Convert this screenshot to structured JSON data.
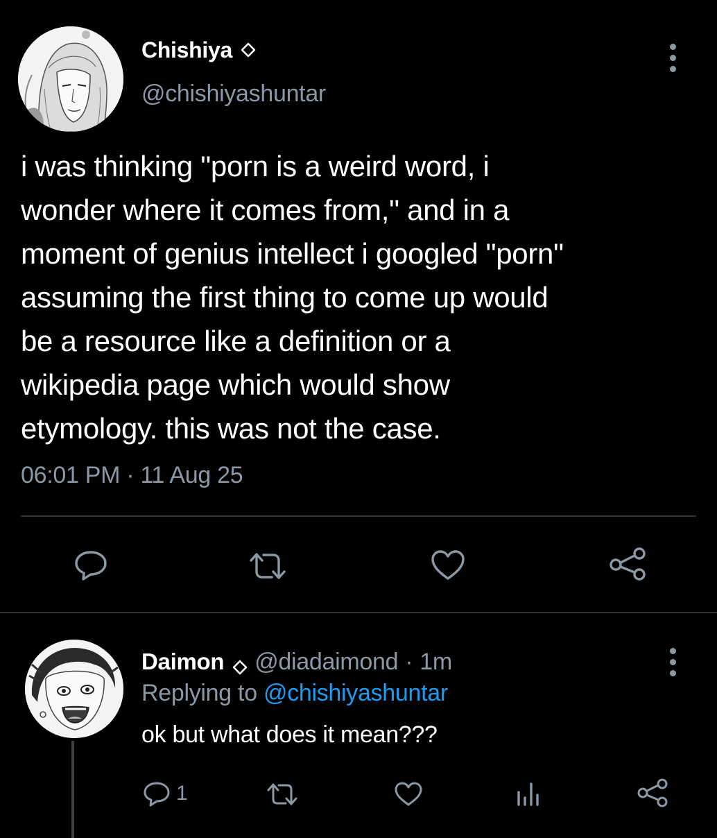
{
  "main_tweet": {
    "display_name": "Chishiya",
    "handle": "@chishiyashuntar",
    "text": "i was thinking \"porn is a weird word, i\nwonder where it comes from,\" and in a\nmoment of genius intellect i googled \"porn\"\nassuming the first thing to come up would\nbe a resource like a definition or a\nwikipedia page which would show\netymology. this was not the case.",
    "timestamp": "06:01 PM · 11 Aug 25",
    "actions": [
      "reply-icon",
      "retweet-icon",
      "like-icon",
      "share-icon"
    ]
  },
  "reply": {
    "display_name": "Daimon",
    "handle": "@diadaimond",
    "separator": "·",
    "time": "1m",
    "replying_prefix": "Replying to ",
    "replying_handle": "@chishiyashuntar",
    "text": "ok but what does it mean???",
    "reply_count": "1",
    "actions": [
      "reply-icon",
      "retweet-icon",
      "like-icon",
      "analytics-icon",
      "share-icon"
    ]
  },
  "colors": {
    "background": "#000000",
    "text": "#ffffff",
    "muted": "#8b98a5",
    "link": "#1d9bf0",
    "divider": "#2f3336"
  }
}
